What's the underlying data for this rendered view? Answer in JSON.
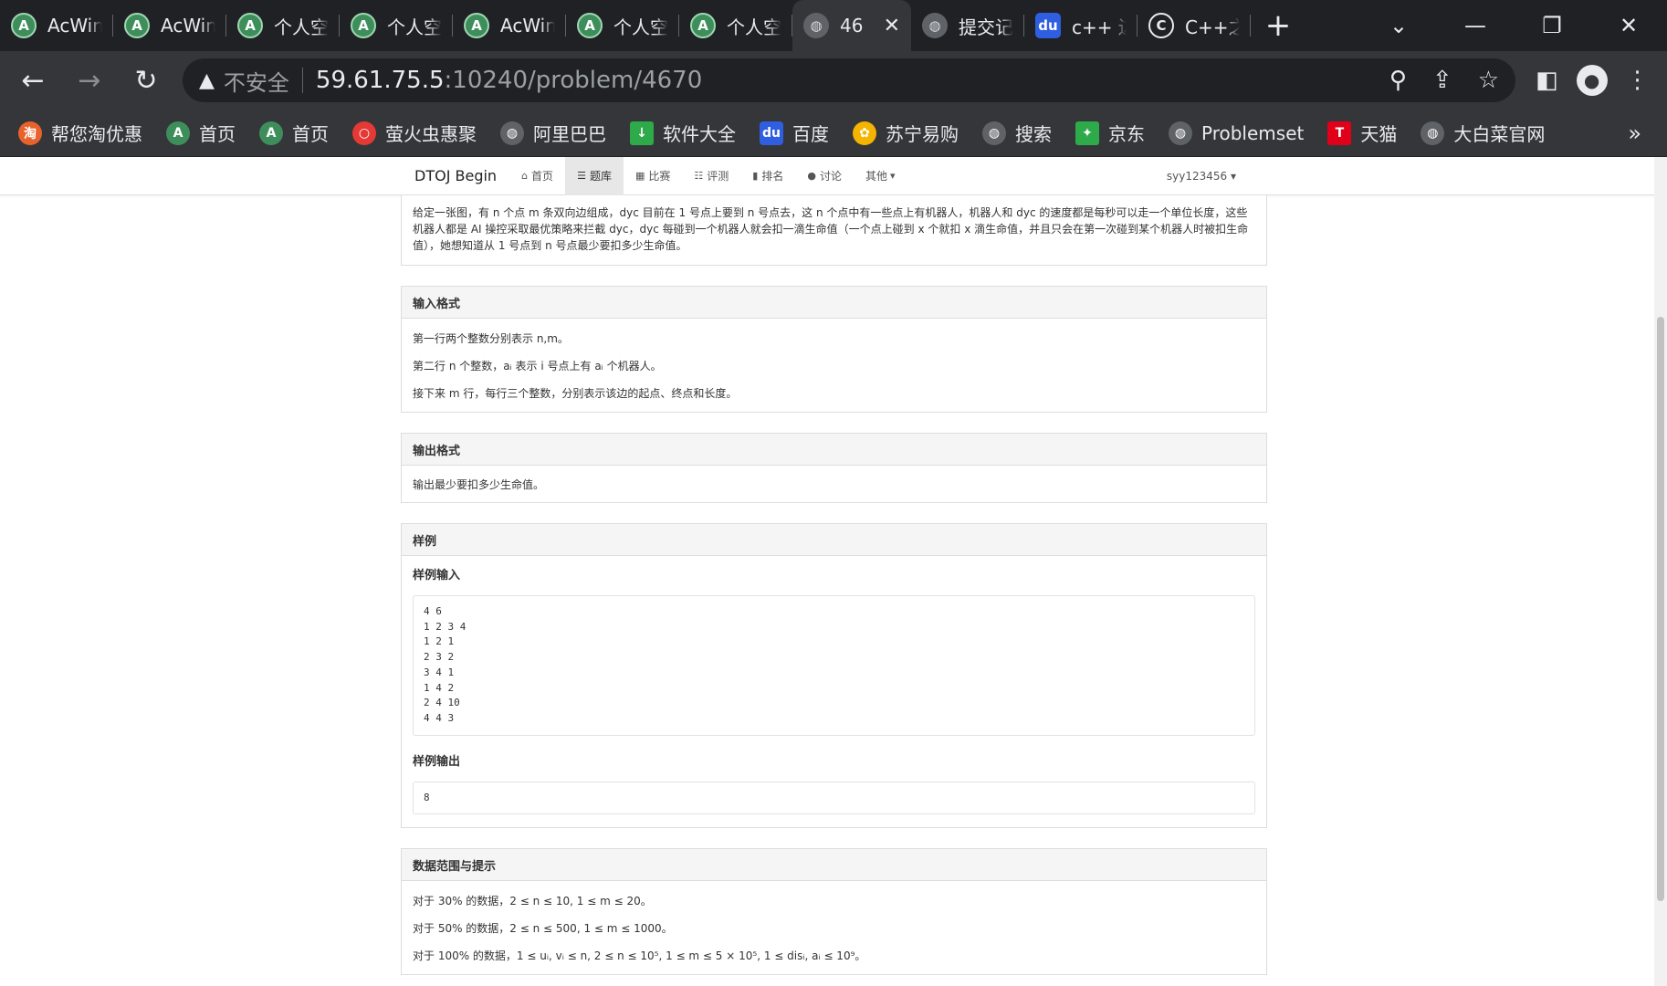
{
  "browser": {
    "tabs": [
      {
        "label": "AcWin",
        "icon": "acwing-icon"
      },
      {
        "label": "AcWin",
        "icon": "acwing-icon"
      },
      {
        "label": "个人空",
        "icon": "acwing-icon"
      },
      {
        "label": "个人空",
        "icon": "acwing-icon"
      },
      {
        "label": "AcWin",
        "icon": "acwing-icon"
      },
      {
        "label": "个人空",
        "icon": "acwing-icon"
      },
      {
        "label": "个人空",
        "icon": "acwing-icon"
      },
      {
        "label": "46",
        "icon": "globe-icon",
        "active": true
      },
      {
        "label": "提交记",
        "icon": "globe-icon"
      },
      {
        "label": "c++ 边",
        "icon": "baidu-icon"
      },
      {
        "label": "C++之",
        "icon": "c-icon"
      }
    ],
    "address": {
      "security_label": "不安全",
      "host": "59.61.75.5",
      "path": ":10240/problem/4670"
    },
    "bookmarks": [
      {
        "label": "帮您淘优惠",
        "icon": "taobao-icon",
        "color": "#e8622c"
      },
      {
        "label": "首页",
        "icon": "acwing-icon",
        "color": "#3e8e5c"
      },
      {
        "label": "首页",
        "icon": "acwing-icon",
        "color": "#3e8e5c"
      },
      {
        "label": "萤火虫惠聚",
        "icon": "firefly-icon",
        "color": "#e53935"
      },
      {
        "label": "阿里巴巴",
        "icon": "globe-icon",
        "color": "#5f6368"
      },
      {
        "label": "软件大全",
        "icon": "download-icon",
        "color": "#2eaa4a"
      },
      {
        "label": "百度",
        "icon": "baidu-icon",
        "color": "#2f5fe0"
      },
      {
        "label": "苏宁易购",
        "icon": "suning-icon",
        "color": "#f4b400"
      },
      {
        "label": "搜索",
        "icon": "globe-icon",
        "color": "#5f6368"
      },
      {
        "label": "京东",
        "icon": "jd-icon",
        "color": "#2eaa4a"
      },
      {
        "label": "Problemset",
        "icon": "globe-icon",
        "color": "#5f6368"
      },
      {
        "label": "天猫",
        "icon": "tmall-icon",
        "color": "#e1001a"
      },
      {
        "label": "大白菜官网",
        "icon": "globe-icon",
        "color": "#5f6368"
      }
    ]
  },
  "site": {
    "brand": "DTOJ Begin",
    "nav": [
      {
        "label": "首页",
        "icon": "home-icon"
      },
      {
        "label": "题库",
        "icon": "list-icon",
        "active": true
      },
      {
        "label": "比赛",
        "icon": "calendar-icon"
      },
      {
        "label": "评测",
        "icon": "tasks-icon"
      },
      {
        "label": "排名",
        "icon": "signal-icon"
      },
      {
        "label": "讨论",
        "icon": "comments-icon"
      },
      {
        "label": "其他",
        "icon": "caret-down-icon"
      }
    ],
    "user": "syy123456"
  },
  "problem": {
    "description": "给定一张图，有 n 个点 m 条双向边组成，dyc 目前在 1 号点上要到 n 号点去，这 n 个点中有一些点上有机器人，机器人和 dyc 的速度都是每秒可以走一个单位长度，这些机器人都是 AI 操控采取最优策略来拦截 dyc，dyc 每碰到一个机器人就会扣一滴生命值（一个点上碰到 x 个就扣 x 滴生命值，并且只会在第一次碰到某个机器人时被扣生命值），她想知道从 1 号点到 n 号点最少要扣多少生命值。",
    "input_title": "输入格式",
    "input_lines": [
      "第一行两个整数分别表示 n,m。",
      "第二行 n 个整数，aᵢ 表示 i 号点上有 aᵢ 个机器人。",
      "接下来 m 行，每行三个整数，分别表示该边的起点、终点和长度。"
    ],
    "output_title": "输出格式",
    "output_text": "输出最少要扣多少生命值。",
    "sample_title": "样例",
    "sample_input_label": "样例输入",
    "sample_input": "4 6\n1 2 3 4\n1 2 1\n2 3 2\n3 4 1\n1 4 2\n2 4 10\n4 4 3",
    "sample_output_label": "样例输出",
    "sample_output": "8",
    "constraints_title": "数据范围与提示",
    "constraints": [
      "对于 30% 的数据，2 ≤ n ≤ 10, 1 ≤ m ≤ 20。",
      "对于 50% 的数据，2 ≤ n ≤ 500, 1 ≤ m ≤ 1000。",
      "对于 100% 的数据，1 ≤ uᵢ, vᵢ ≤ n, 2 ≤ n ≤ 10⁵, 1 ≤ m ≤ 5 × 10⁵, 1 ≤ disᵢ, aᵢ ≤ 10⁹。"
    ]
  }
}
